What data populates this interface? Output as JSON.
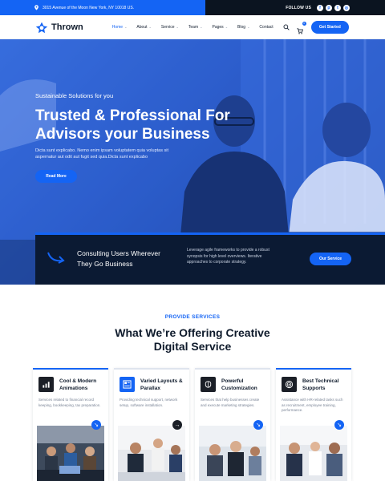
{
  "topbar": {
    "address": "3015 Avenue of the Moon New York, NY 10018 US.",
    "follow_label": "FOLLOW US",
    "social_icons": [
      "facebook-icon",
      "pinterest-icon",
      "twitter-icon",
      "instagram-icon"
    ]
  },
  "header": {
    "brand": "Thrown",
    "nav": [
      {
        "label": "Home",
        "dropdown": true,
        "active": true
      },
      {
        "label": "About",
        "dropdown": true
      },
      {
        "label": "Service",
        "dropdown": true
      },
      {
        "label": "Team",
        "dropdown": true
      },
      {
        "label": "Pages",
        "dropdown": true
      },
      {
        "label": "Blog",
        "dropdown": true
      },
      {
        "label": "Contact",
        "dropdown": false
      }
    ],
    "cart_count": "0",
    "cta_label": "Get Started"
  },
  "hero": {
    "subtitle": "Sustainable Solutions for you",
    "title_line1": "Trusted & Professional For",
    "title_line2": "Advisors your Business",
    "description": "Dicta sunt explicabo. Nemo enim ipsam voluptatem quia voluptas sit aspernatur aut odit aut fugit sed quia.Dicta sunt explicabo",
    "button_label": "Read More"
  },
  "consult": {
    "title": "Consulting Users Wherever They Go Business",
    "text": "Leverage agile frameworks to provide a robust synopsis for high level overviews. Iterative approaches to corporate strategy.",
    "button_label": "Our Service"
  },
  "services": {
    "eyebrow": "PROVIDE SERVICES",
    "title_line1": "What We’re Offering Creative",
    "title_line2": "Digital Service",
    "cards": [
      {
        "title": "Cool & Modern Animations",
        "text": "Services related to financial record keeping, bookkeeping, tax preparation.",
        "icon": "chart-icon"
      },
      {
        "title": "Varied Layouts & Parallax",
        "text": "Providing technical support, network setup, software installation.",
        "icon": "layout-icon"
      },
      {
        "title": "Powerful Customization",
        "text": "Services that help businesses create and execute marketing strategies.",
        "icon": "brain-icon"
      },
      {
        "title": "Best Technical Supports",
        "text": "Assistance with HR-related tasks such as recruitment, employee training, performance.",
        "icon": "target-icon"
      }
    ]
  },
  "colors": {
    "accent": "#1464f4",
    "dark": "#0b1420",
    "navy": "#0b1a33"
  }
}
